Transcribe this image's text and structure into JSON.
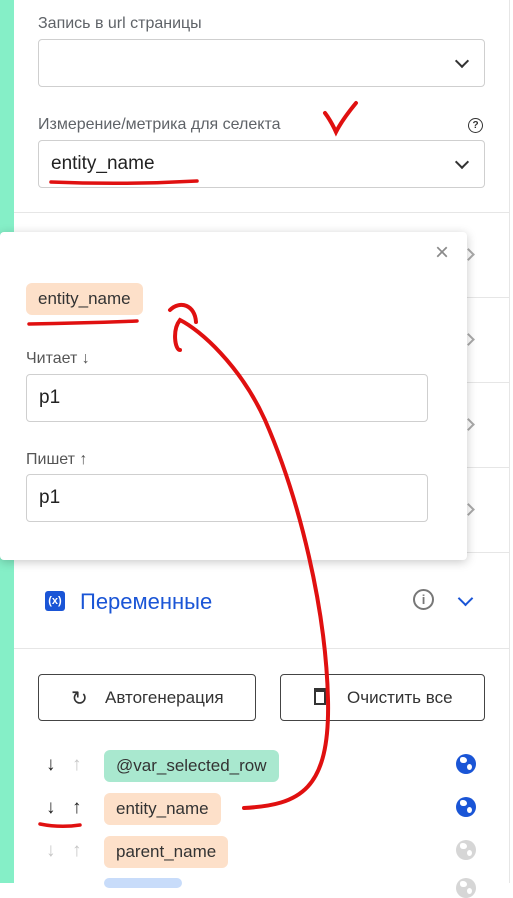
{
  "form": {
    "url_label": "Запись в url страницы",
    "url_value": "",
    "metric_label": "Измерение/метрика для селекта",
    "metric_value": "entity_name"
  },
  "popup": {
    "chip": "entity_name",
    "reads_label": "Читает ↓",
    "reads_value": "p1",
    "writes_label": "Пишет ↑",
    "writes_value": "p1"
  },
  "variables": {
    "title": "Переменные",
    "autogen_label": "Автогенерация",
    "clear_label": "Очистить все",
    "rows": [
      {
        "name": "@var_selected_row",
        "down_active": true,
        "up_active": false,
        "global": true
      },
      {
        "name": "entity_name",
        "down_active": true,
        "up_active": true,
        "global": true
      },
      {
        "name": "parent_name",
        "down_active": false,
        "up_active": false,
        "global": false
      }
    ]
  },
  "colors": {
    "accent": "#1a55d6",
    "strip": "#85efc7",
    "annotation": "#e01010"
  }
}
